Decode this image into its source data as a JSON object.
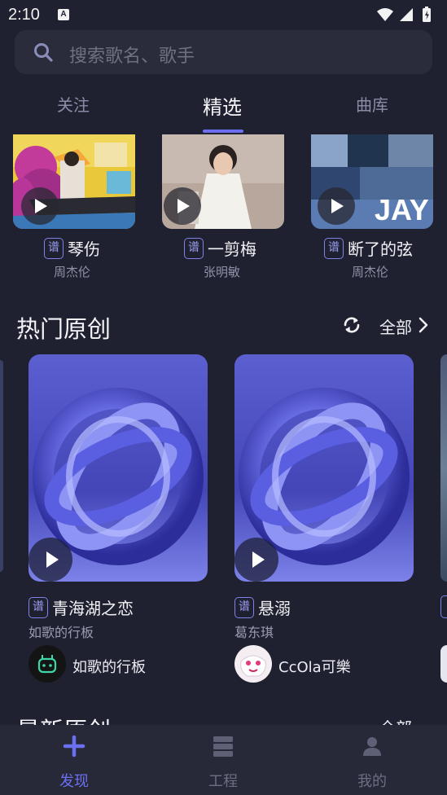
{
  "status_bar": {
    "time": "2:10",
    "notification_letter": "A"
  },
  "search": {
    "placeholder": "搜索歌名、歌手"
  },
  "tabs": [
    {
      "label": "关注",
      "active": false
    },
    {
      "label": "精选",
      "active": true
    },
    {
      "label": "曲库",
      "active": false
    }
  ],
  "songs": [
    {
      "badge": "谱",
      "title": "琴伤",
      "artist": "周杰伦"
    },
    {
      "badge": "谱",
      "title": "一剪梅",
      "artist": "张明敏"
    },
    {
      "badge": "谱",
      "title": "断了的弦",
      "artist": "周杰伦",
      "cover_text": "JAY"
    }
  ],
  "hot_originals": {
    "title": "热门原创",
    "all_label": "全部",
    "items": [
      {
        "badge": "谱",
        "title": "青海湖之恋",
        "subtitle": "如歌的行板",
        "user": "如歌的行板"
      },
      {
        "badge": "谱",
        "title": "悬溺",
        "subtitle": "葛东琪",
        "user": "CcOla可樂"
      }
    ]
  },
  "latest_originals": {
    "title": "最新原创",
    "all_label": "全部"
  },
  "bottom_nav": [
    {
      "label": "发现",
      "active": true,
      "icon": "plus-icon"
    },
    {
      "label": "工程",
      "active": false,
      "icon": "layers-icon"
    },
    {
      "label": "我的",
      "active": false,
      "icon": "person-icon"
    }
  ],
  "colors": {
    "accent": "#6c70f0",
    "background": "#1f2130",
    "muted": "#8f92a8"
  }
}
